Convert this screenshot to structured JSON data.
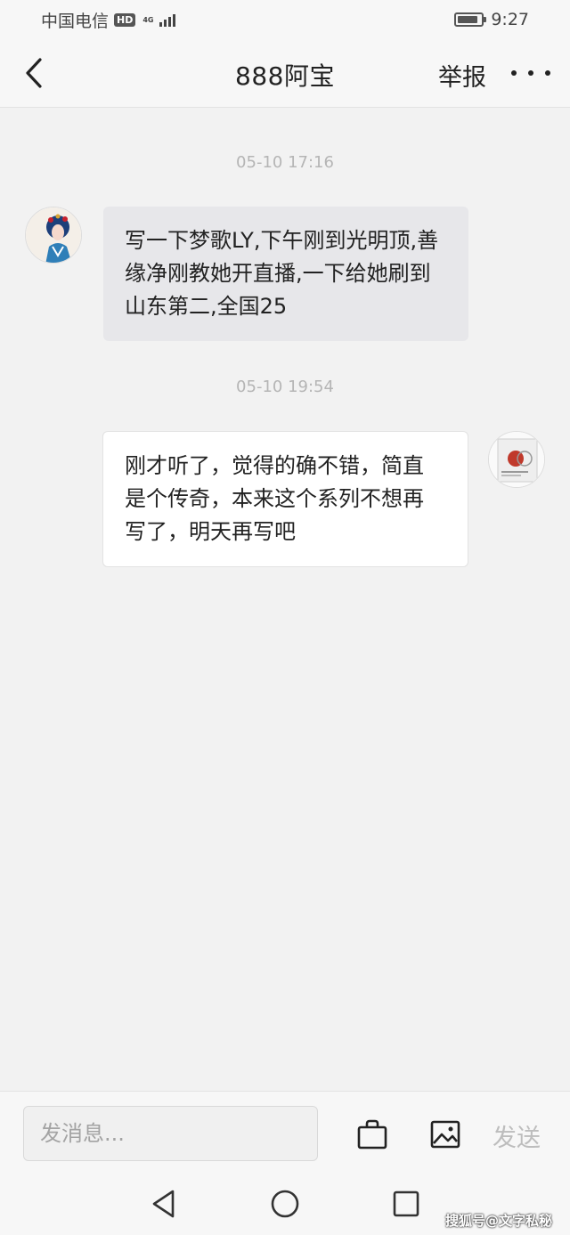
{
  "status_bar": {
    "carrier": "中国电信",
    "hd_badge": "HD",
    "network": "4G",
    "time": "9:27"
  },
  "header": {
    "title": "888阿宝",
    "report_label": "举报",
    "back_icon": "chevron-left-icon",
    "more_icon": "more-dots-icon"
  },
  "messages": [
    {
      "timestamp": "05-10 17:16",
      "direction": "incoming",
      "text": "写一下梦歌LY,下午刚到光明顶,善缘净刚教她开直播,一下给她刷到山东第二,全国25"
    },
    {
      "timestamp": "05-10 19:54",
      "direction": "outgoing",
      "text": "刚才听了，觉得的确不错，简直是个传奇，本来这个系列不想再写了，明天再写吧"
    }
  ],
  "input_bar": {
    "placeholder": "发消息...",
    "send_label": "发送",
    "gift_icon": "bag-icon",
    "image_icon": "image-icon"
  },
  "nav_bar": {
    "back_icon": "triangle-back-icon",
    "home_icon": "circle-home-icon",
    "recent_icon": "square-recent-icon"
  },
  "watermark": "搜狐号@文字私秘",
  "colors": {
    "background": "#f2f2f2",
    "incoming_bubble": "#e7e7ea",
    "outgoing_bubble": "#ffffff",
    "send_disabled": "#bdbdbd"
  }
}
